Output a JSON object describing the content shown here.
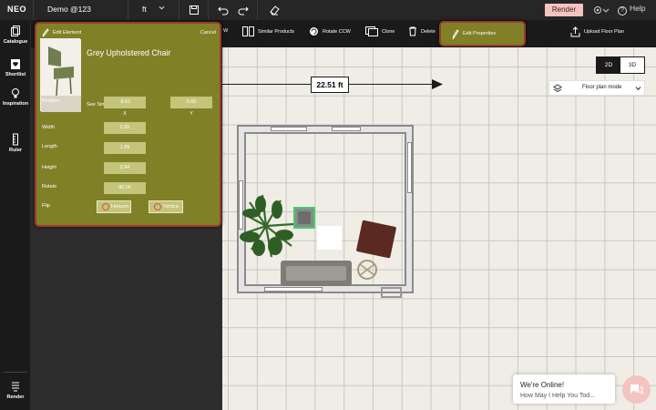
{
  "app": {
    "logo": "NEO",
    "project_name": "Demo @123",
    "unit": "ft"
  },
  "topbar": {
    "icons": [
      "save-icon",
      "undo-icon",
      "redo-icon",
      "eraser-icon"
    ],
    "render_label": "Render",
    "help_label": "Help"
  },
  "leftnav": {
    "items": [
      {
        "label": "Catalogue",
        "icon": "catalogue-icon"
      },
      {
        "label": "Shortlist",
        "icon": "shortlist-icon"
      },
      {
        "label": "Inspiration",
        "icon": "lightbulb-icon"
      },
      {
        "label": "Ruler",
        "icon": "ruler-icon"
      },
      {
        "label": "Render",
        "icon": "render-icon"
      }
    ]
  },
  "toolbar": {
    "partial_label": "W",
    "similar_products": "Similar Products",
    "rotate_ccw": "Rotate CCW",
    "clone": "Clone",
    "delete": "Delete",
    "edit_properties": "Edit Properties",
    "upload_floor_plan": "Upload Floor Plan"
  },
  "view": {
    "mode_2d": "2D",
    "mode_3d": "3D",
    "selected": "2D",
    "floor_mode": "Floor plan mode"
  },
  "dimension": {
    "label": "22.51 ft"
  },
  "panel": {
    "title": "Edit Element",
    "cancel": "Cancel",
    "product_name": "Grey Upholstered Chair",
    "see_similar": "See Similar Products",
    "position_label": "Position",
    "position_x": "-8.51",
    "position_y": "5.60",
    "axis_x": "X",
    "axis_y": "Y",
    "width_label": "Width",
    "width_value": "2.00",
    "length_label": "Length",
    "length_value": "1.89",
    "height_label": "Height",
    "height_value": "2.94",
    "rotate_label": "Rotate",
    "rotate_value": "90.00",
    "flip_label": "Flip",
    "flip_horizontal": "Horizon",
    "flip_vertical": "Vertica"
  },
  "chat": {
    "line1": "We're Online!",
    "line2": "How May I Help You Tod..."
  },
  "colors": {
    "accent": "#808027",
    "highlight_border": "#9e3a2c",
    "render_btn": "#f4c4c0"
  }
}
